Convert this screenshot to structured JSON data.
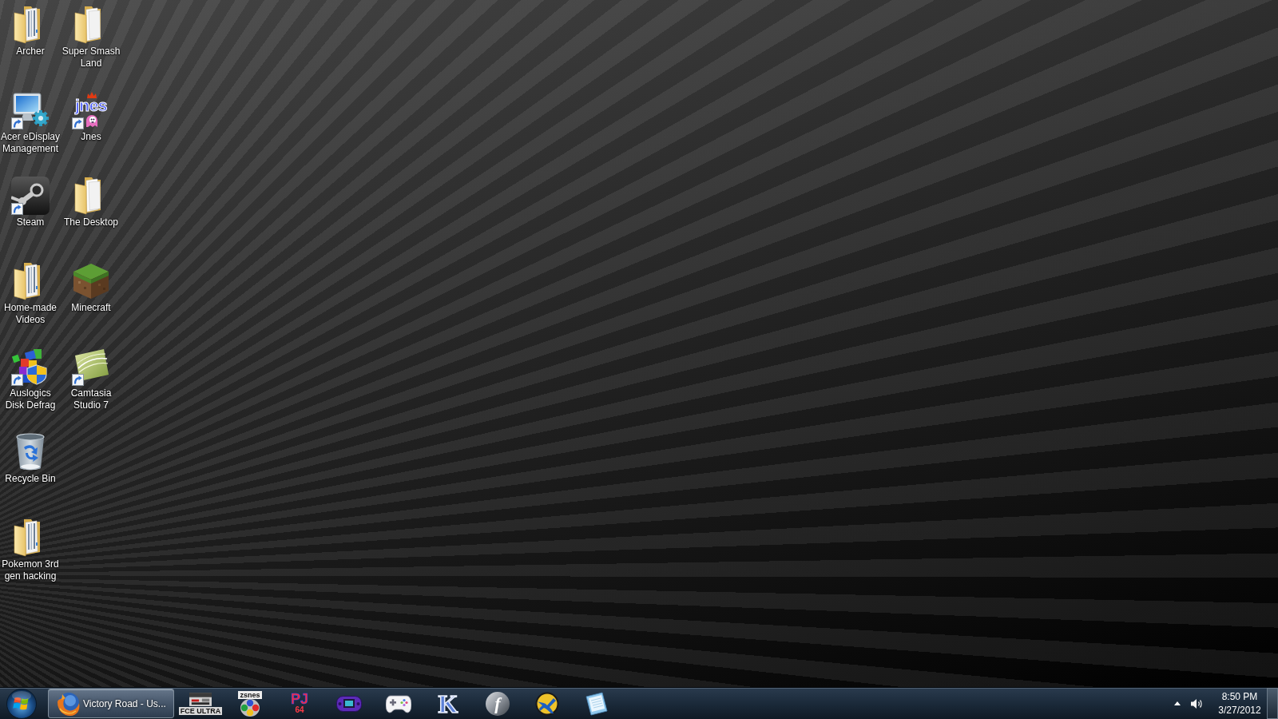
{
  "desktop_icons": [
    {
      "label": "Archer",
      "kind": "folder_docs",
      "shortcut": false
    },
    {
      "label": "Acer eDisplay Management",
      "kind": "monitor",
      "shortcut": true
    },
    {
      "label": "Steam",
      "kind": "tile_logo",
      "shortcut": true
    },
    {
      "label": "Home-made Videos",
      "kind": "folder_docs",
      "shortcut": false
    },
    {
      "label": "Auslogics Disk Defrag",
      "kind": "cubes_shield",
      "shortcut": true
    },
    {
      "label": "Recycle Bin",
      "kind": "recycle_bin",
      "shortcut": false
    },
    {
      "label": "Pokemon 3rd gen hacking",
      "kind": "folder_docs",
      "shortcut": false
    },
    {
      "label": "Super Smash Land",
      "kind": "folder_pages",
      "shortcut": false
    },
    {
      "label": "Jnes",
      "kind": "jnes",
      "logo_text": "jnes",
      "shortcut": true
    },
    {
      "label": "The Desktop",
      "kind": "folder_pages",
      "shortcut": false
    },
    {
      "label": "Minecraft",
      "kind": "grass_block",
      "shortcut": false
    },
    {
      "label": "Camtasia Studio 7",
      "kind": "swoosh_tile",
      "shortcut": true
    }
  ],
  "taskbar": {
    "window_buttons": [
      {
        "title": "Victory Road - Us...",
        "kind": "browser"
      }
    ],
    "pinned": [
      {
        "kind": "nes",
        "logo_text": "FCE ULTRA"
      },
      {
        "kind": "zsnes",
        "logo_text": "zsnes"
      },
      {
        "kind": "pj64",
        "logo_lines": [
          "PJ",
          "64"
        ]
      },
      {
        "kind": "gba"
      },
      {
        "kind": "gamepad"
      },
      {
        "kind": "letter",
        "logo_text": "K"
      },
      {
        "kind": "disc",
        "logo_text": "f"
      },
      {
        "kind": "globe"
      },
      {
        "kind": "notepad"
      }
    ],
    "clock": {
      "time": "8:50 PM",
      "date": "3/27/2012"
    }
  }
}
